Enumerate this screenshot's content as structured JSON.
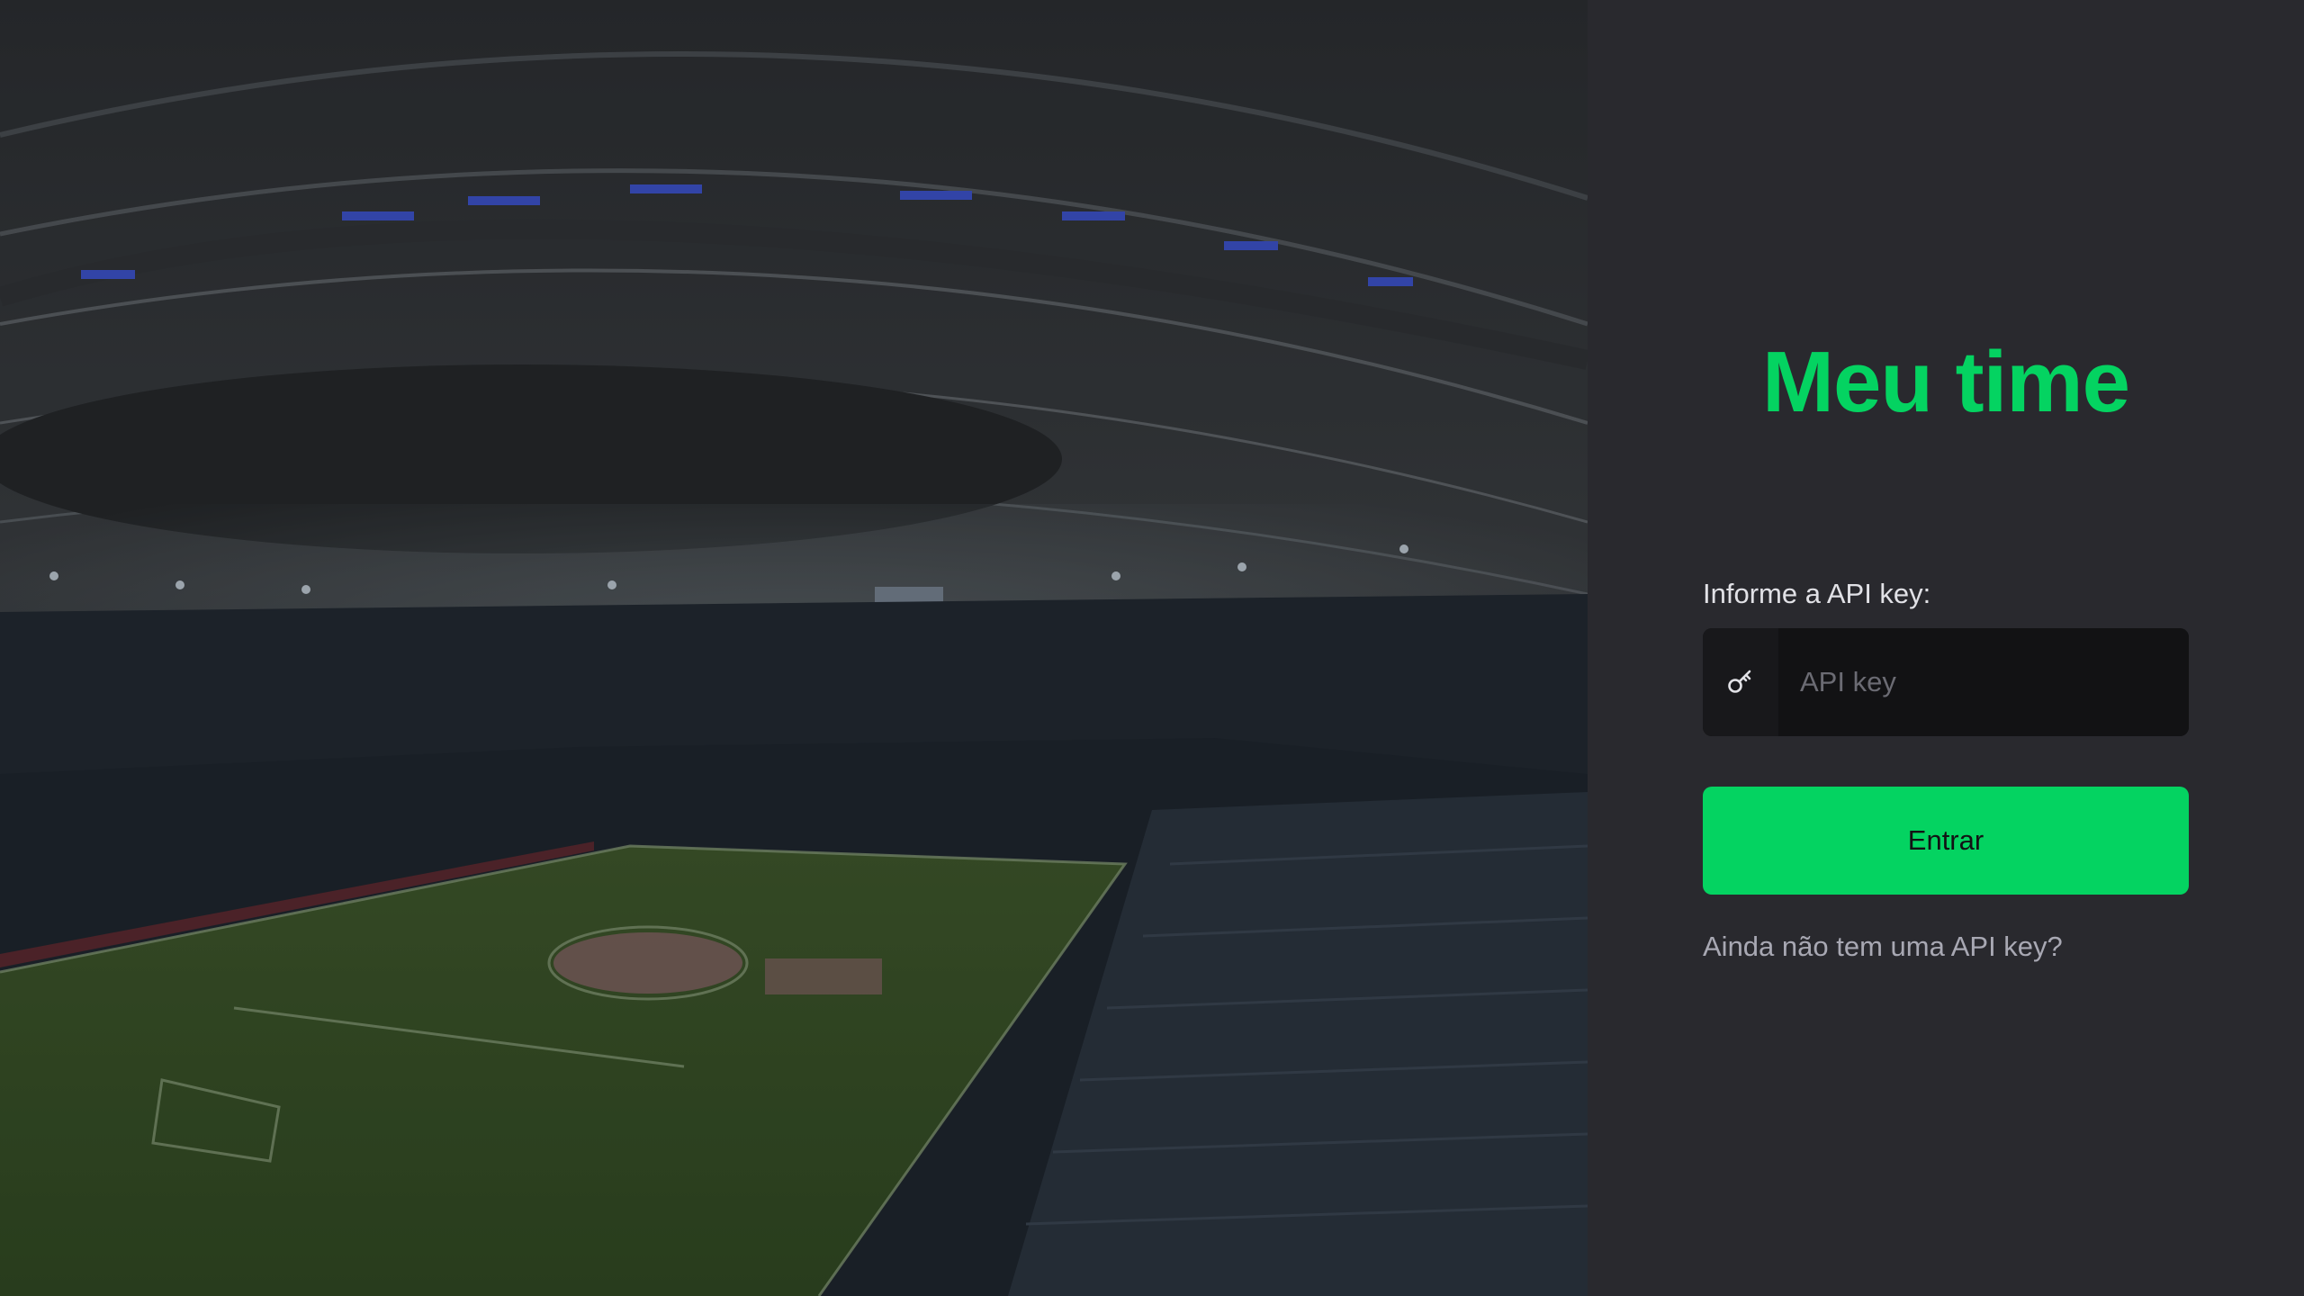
{
  "app": {
    "title": "Meu time"
  },
  "login": {
    "label": "Informe a API key:",
    "input_placeholder": "API key",
    "input_value": "",
    "submit_label": "Entrar",
    "help_link": "Ainda não tem uma API key?"
  },
  "icons": {
    "input_icon": "key-icon"
  },
  "colors": {
    "accent": "#04d361",
    "panel_background": "#29292e",
    "input_background": "#121214",
    "label_text": "#e1e1e6",
    "muted_text": "#a8a8b3"
  }
}
